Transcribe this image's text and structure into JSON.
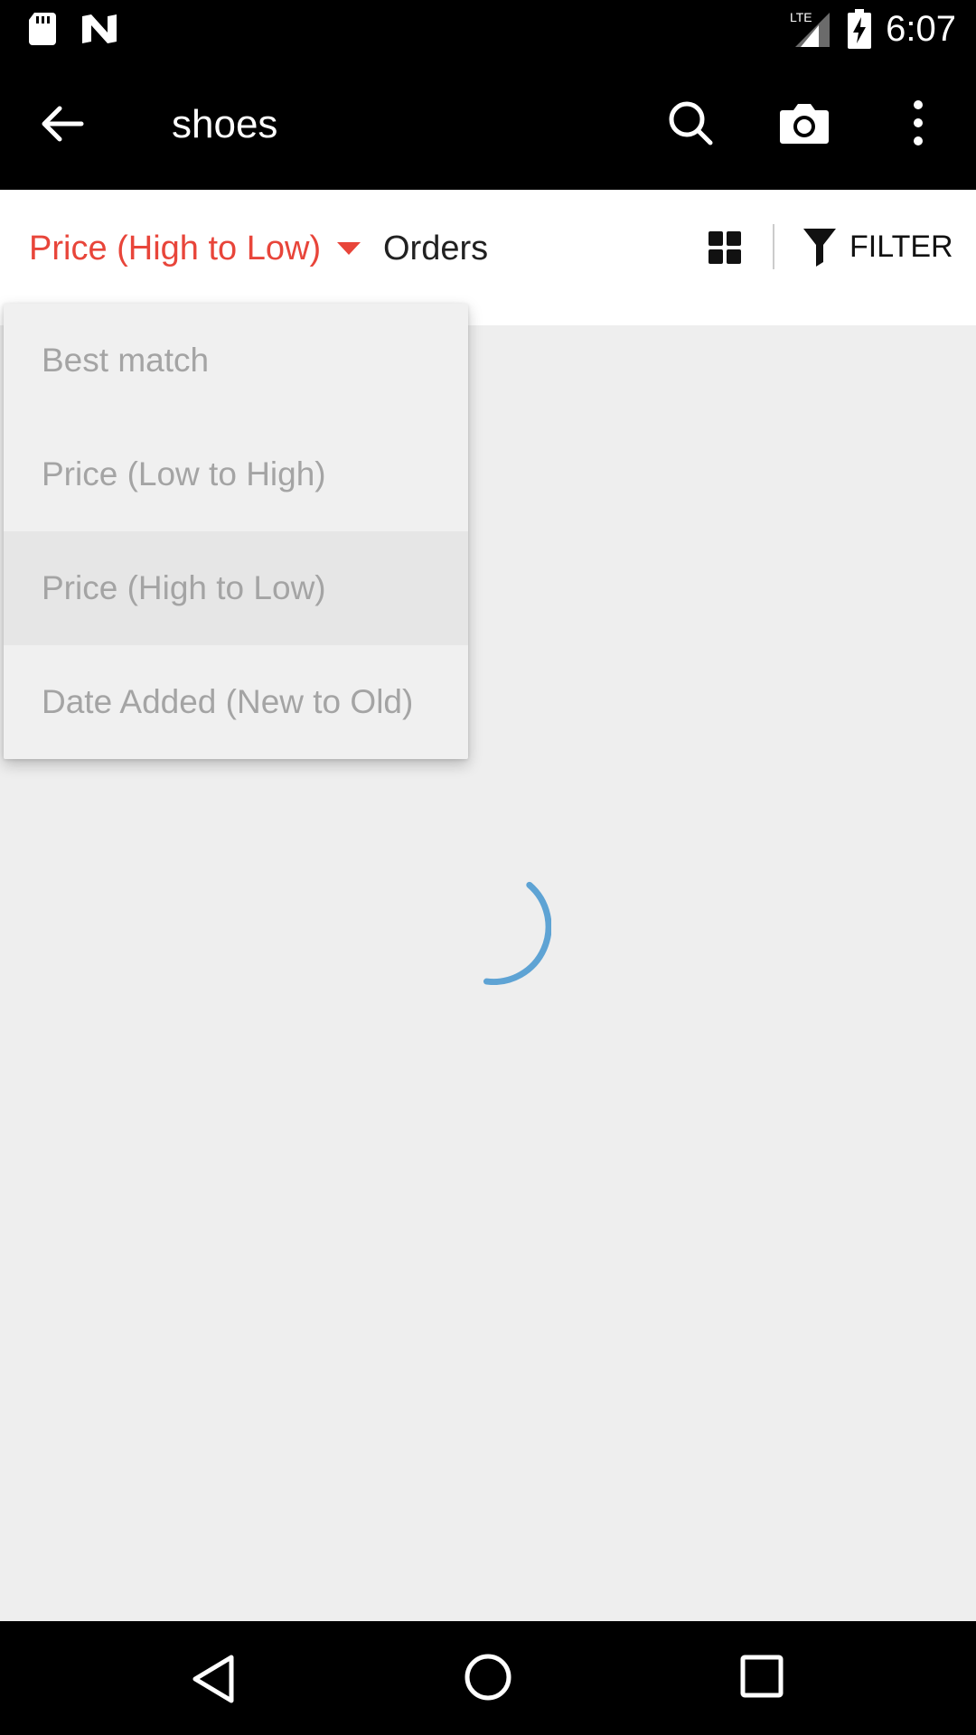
{
  "status_bar": {
    "time": "6:07",
    "network": "LTE",
    "icons": [
      "sd-card-icon",
      "n-notification-icon",
      "lte-signal-icon",
      "battery-charging-icon"
    ]
  },
  "app_bar": {
    "query": "shoes",
    "icons": [
      "back-arrow-icon",
      "search-icon",
      "camera-icon",
      "more-vert-icon"
    ],
    "color": "#000000"
  },
  "sort_bar": {
    "selected_sort": "Price (High to Low)",
    "orders_label": "Orders",
    "filter_label": "FILTER",
    "accent_color": "#e8453a",
    "icons": [
      "grid-view-icon",
      "filter-funnel-icon",
      "caret-down-icon"
    ]
  },
  "dropdown": {
    "options": [
      {
        "label": "Best match",
        "selected": false
      },
      {
        "label": "Price (Low to High)",
        "selected": false
      },
      {
        "label": "Price (High to Low)",
        "selected": true
      },
      {
        "label": "Date Added (New to Old)",
        "selected": false
      }
    ]
  },
  "loading": {
    "icon": "loading-spinner-icon",
    "color": "#5ea3d4"
  },
  "nav_bar": {
    "icons": [
      "nav-back-icon",
      "nav-home-icon",
      "nav-recents-icon"
    ]
  }
}
